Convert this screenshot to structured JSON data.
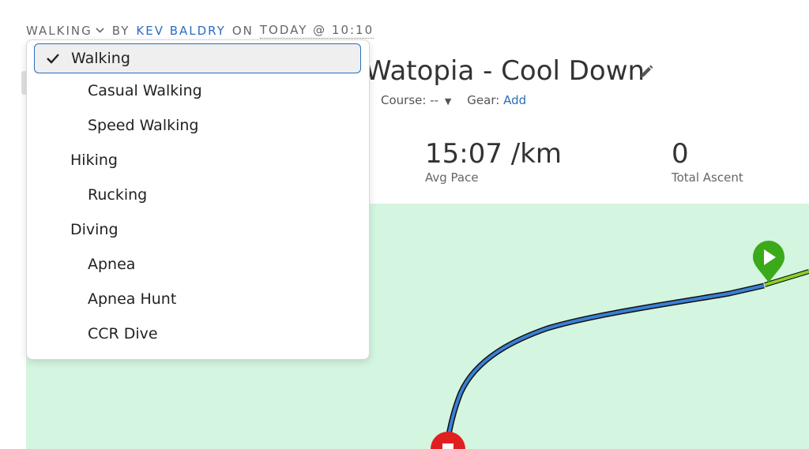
{
  "header": {
    "activity_type": "WALKING",
    "by_label": "BY",
    "author": "KEV BALDRY",
    "on_label": "ON",
    "date": "TODAY @ 10:10"
  },
  "activity": {
    "title": "Watopia - Cool Down",
    "course_label": "Course:",
    "course_value": "--",
    "gear_label": "Gear:",
    "gear_action": "Add"
  },
  "stats": [
    {
      "value": "15:07 /km",
      "label": "Avg Pace"
    },
    {
      "value": "0",
      "label": "Total Ascent"
    }
  ],
  "type_menu": {
    "selected": "Walking",
    "options": [
      {
        "label": "Walking",
        "level": 0
      },
      {
        "label": "Casual Walking",
        "level": 1
      },
      {
        "label": "Speed Walking",
        "level": 1
      },
      {
        "label": "Hiking",
        "level": 0
      },
      {
        "label": "Rucking",
        "level": 1
      },
      {
        "label": "Diving",
        "level": 0
      },
      {
        "label": "Apnea",
        "level": 1
      },
      {
        "label": "Apnea Hunt",
        "level": 1
      },
      {
        "label": "CCR Dive",
        "level": 1
      }
    ]
  },
  "colors": {
    "accent": "#2a6ebb",
    "map_background": "#d4f5df",
    "route": "#3a7fd4",
    "start_marker": "#3aaa1a",
    "end_marker": "#e02020"
  },
  "icons": {
    "edit": "pencil-icon",
    "check": "checkmark-icon",
    "start": "play-marker-icon",
    "end": "stop-marker-icon",
    "chevron": "chevron-down-icon"
  }
}
